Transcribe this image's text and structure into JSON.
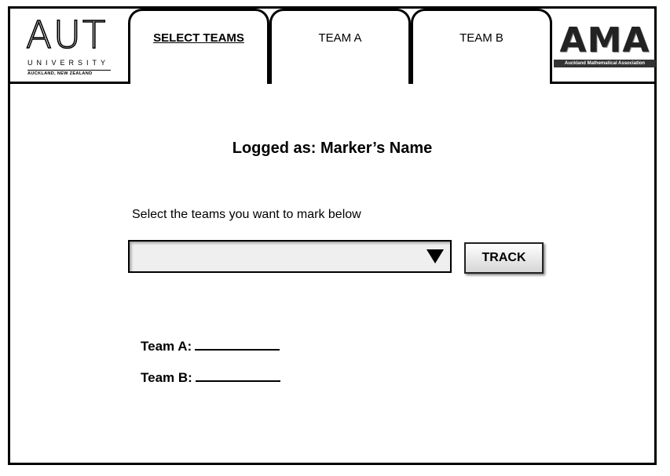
{
  "header": {
    "left_logo": {
      "letters": "AUT",
      "university": "UNIVERSITY",
      "location": "AUCKLAND, NEW ZEALAND"
    },
    "tabs": [
      {
        "label": "SELECT TEAMS",
        "active": true
      },
      {
        "label": "TEAM A",
        "active": false
      },
      {
        "label": "TEAM B",
        "active": false
      }
    ],
    "right_logo": {
      "letters": "AMA",
      "subtitle": "Auckland Mathematical Association"
    }
  },
  "main": {
    "logged_as": "Logged as: Marker’s Name",
    "instruction": "Select the teams you want to mark below",
    "team_select": {
      "selected_value": "",
      "arrow_icon": "triangle-down-icon"
    },
    "track_button": "TRACK",
    "team_a_label": "Team A:",
    "team_b_label": "Team B:"
  }
}
